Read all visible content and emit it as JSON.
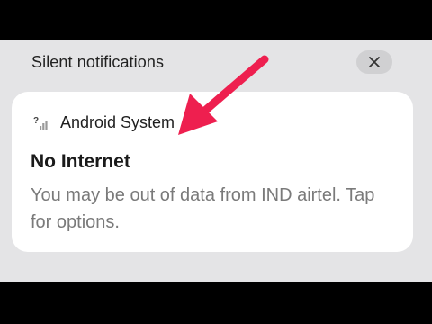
{
  "panel": {
    "title": "Silent notifications",
    "close_icon": "close-icon"
  },
  "notification": {
    "app_icon": "signal-no-internet-icon",
    "app_name": "Android System",
    "title": "No Internet",
    "body": "You may be out of data from IND airtel. Tap for options."
  },
  "annotation": {
    "arrow_color": "#ee1f4f"
  },
  "colors": {
    "panel_background": "#e4e4e6",
    "card_background": "#ffffff",
    "body_text": "#7a7a7a"
  }
}
